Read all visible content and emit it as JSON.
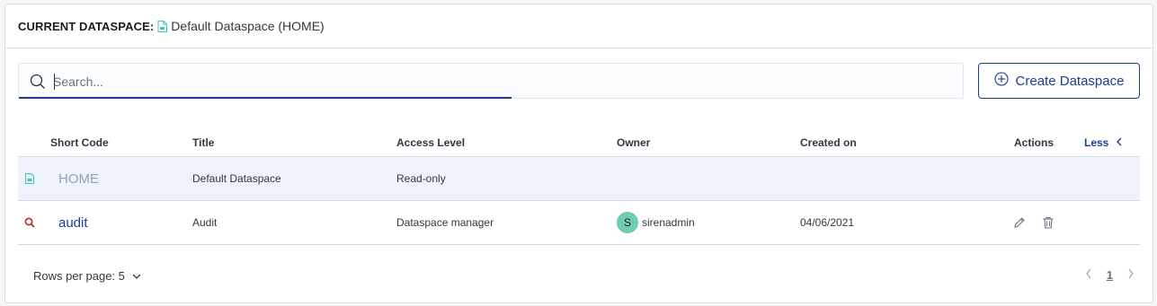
{
  "header": {
    "label": "CURRENT DATASPACE:",
    "dataspace_name": "Default Dataspace (HOME)"
  },
  "search": {
    "placeholder": "Search..."
  },
  "toolbar": {
    "create_label": "Create Dataspace"
  },
  "table": {
    "columns": {
      "short_code": "Short Code",
      "title": "Title",
      "access_level": "Access Level",
      "owner": "Owner",
      "created_on": "Created on",
      "actions": "Actions",
      "less": "Less"
    },
    "rows": [
      {
        "short_code": "HOME",
        "title": "Default Dataspace",
        "access_level": "Read-only",
        "owner": "",
        "owner_initial": "",
        "created_on": "",
        "icon": "document-icon",
        "selected": true
      },
      {
        "short_code": "audit",
        "title": "Audit",
        "access_level": "Dataspace manager",
        "owner": "sirenadmin",
        "owner_initial": "S",
        "created_on": "04/06/2021",
        "icon": "search-icon",
        "selected": false
      }
    ]
  },
  "footer": {
    "rows_per_page": "Rows per page: 5",
    "current_page": "1"
  },
  "colors": {
    "accent": "#1d3c8f",
    "home_icon": "#3dc7b6",
    "audit_icon": "#bd271e",
    "avatar": "#6dccb1",
    "selected_row": "#eef2fa"
  }
}
